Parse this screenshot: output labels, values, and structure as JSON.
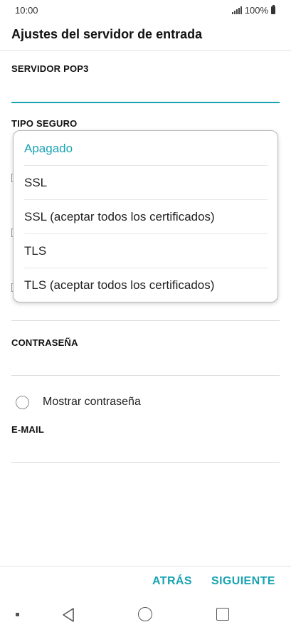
{
  "status_bar": {
    "time": "10:00",
    "battery": "100%"
  },
  "header": {
    "title": "Ajustes del servidor de entrada"
  },
  "form": {
    "server_label": "SERVIDOR POP3",
    "server_value": "",
    "security_label": "TIPO SEGURO",
    "password_label": "CONTRASEÑA",
    "password_value": "",
    "show_password_label": "Mostrar contraseña",
    "email_label": "E-MAIL",
    "email_value": ""
  },
  "security_dropdown": {
    "selected": "Apagado",
    "options": [
      "Apagado",
      "SSL",
      "SSL (aceptar todos los certificados)",
      "TLS",
      "TLS (aceptar todos los certificados)"
    ]
  },
  "actions": {
    "back_label": "ATRÁS",
    "next_label": "SIGUIENTE"
  },
  "colors": {
    "accent": "#1aa3b3"
  },
  "icons": {
    "signal": "signal-icon",
    "battery": "battery-icon",
    "nav_back": "back-triangle-icon",
    "nav_home": "home-circle-icon",
    "nav_recent": "recent-apps-icon"
  }
}
